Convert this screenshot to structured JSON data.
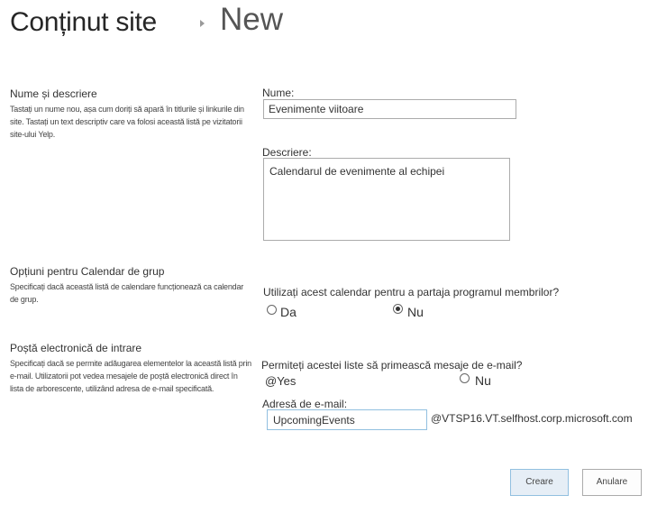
{
  "header": {
    "title": "Conținut site",
    "breadcrumb_current": "New"
  },
  "name_section": {
    "heading": "Nume și descriere",
    "description": "Tastați un nume nou, așa cum doriți să apară în titlurile și linkurile din site. Tastați un text descriptiv care va folosi această listă pe vizitatorii site-ului Yelp.",
    "name_label": "Nume:",
    "name_value": "Evenimente viitoare",
    "desc_label": "Descriere:",
    "desc_value": "Calendarul de evenimente al echipei"
  },
  "calendar_section": {
    "heading": "Opțiuni pentru Calendar de grup",
    "description": "Specificați dacă această listă de calendare funcționează ca calendar de grup.",
    "question": "Utilizați acest calendar pentru a partaja programul membrilor?",
    "option_yes": "Da",
    "option_no": "Nu",
    "selected": "Nu"
  },
  "email_section": {
    "heading": "Poștă electronică de intrare",
    "description": "Specificați dacă se permite adăugarea elementelor la această listă prin e-mail. Utilizatorii pot vedea mesajele de poștă electronică direct în lista de arborescente, utilizând adresa de e-mail specificată.",
    "question": "Permiteți acestei liste să primească mesaje de e-mail?",
    "option_yes": "@Yes",
    "option_no": "Nu",
    "address_label": "Adresă de e-mail:",
    "address_value": "UpcomingEvents",
    "domain_suffix": "@VTSP16.VT.selfhost.corp.microsoft.com"
  },
  "footer": {
    "create_label": "Creare",
    "cancel_label": "Anulare"
  }
}
